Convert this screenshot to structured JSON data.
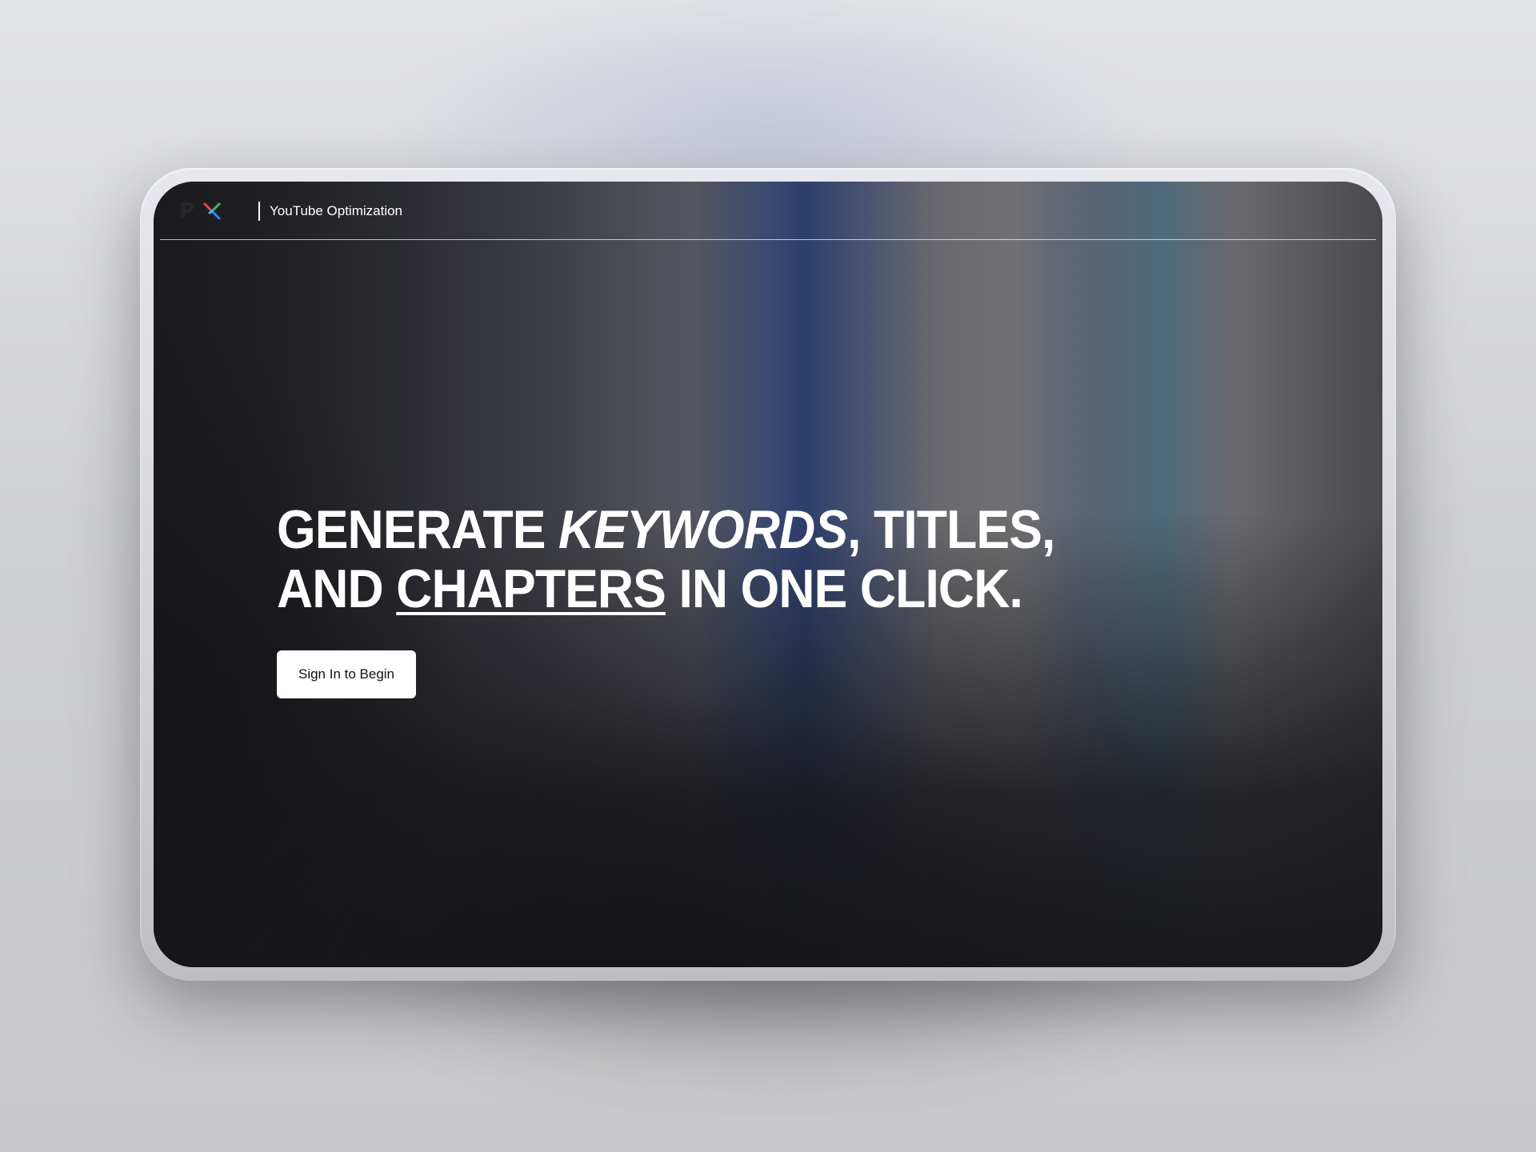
{
  "header": {
    "logo_letter": "P",
    "product_name": "YouTube Optimization"
  },
  "hero": {
    "headline": {
      "line1_part1": "GENERATE ",
      "line1_emphasis": "KEYWORDS",
      "line1_part2": ", TITLES,",
      "line2_part1": "AND ",
      "line2_underlined": "CHAPTERS",
      "line2_part2": " IN ONE CLICK."
    },
    "cta_label": "Sign In to Begin"
  },
  "icons": {
    "logo_mark": "multicolor-x-logo-icon"
  },
  "colors": {
    "screen_background": "#19191d",
    "text": "#ffffff",
    "cta_background": "#ffffff",
    "cta_text": "#111114",
    "logo_red": "#e5484d",
    "logo_green": "#3fb950",
    "logo_blue": "#3b82f6",
    "logo_cyan": "#38bdf8"
  }
}
